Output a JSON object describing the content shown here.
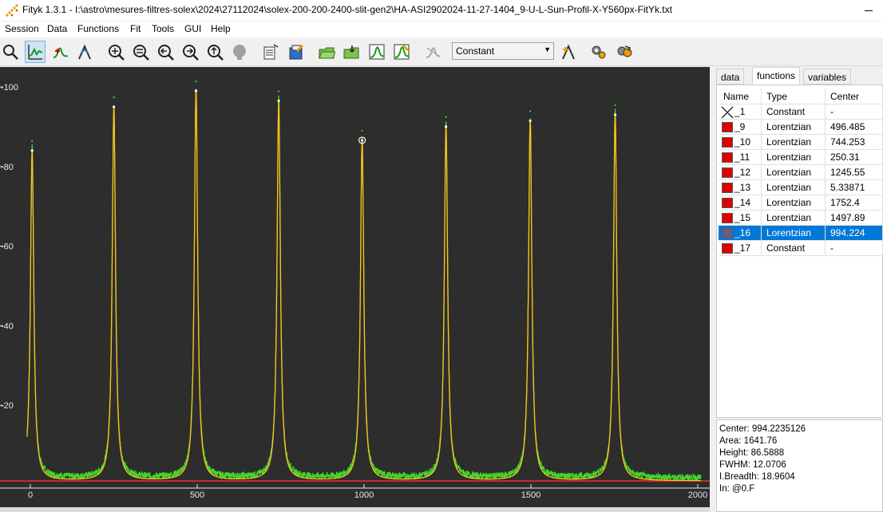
{
  "window": {
    "title": "Fityk 1.3.1 - I:\\astro\\mesures-filtres-solex\\2024\\27112024\\solex-200-200-2400-slit-gen2\\HA-ASI2902024-11-27-1404_9-U-L-Sun-Profil-X-Y560px-FitYk.txt"
  },
  "menu": [
    "Session",
    "Data",
    "Functions",
    "Fit",
    "Tools",
    "GUI",
    "Help"
  ],
  "toolbar": {
    "function_type": "Constant",
    "icons": [
      "zoom-mode-icon",
      "data-range-mode-icon",
      "add-peak-mode-icon",
      "baseline-mode-icon",
      "zoom-all-icon",
      "zoom-vertical-icon",
      "zoom-prev-icon",
      "zoom-in-icon",
      "zoom-up-icon",
      "disabled-circle-icon",
      "load-data-icon",
      "edit-data-icon",
      "open-session-icon",
      "save-session-icon",
      "run-fit-icon",
      "fit-settings-icon",
      "disabled-fit-icon",
      "guess-peak-icon",
      "run-script-icon",
      "continue-icon"
    ]
  },
  "colors": {
    "plot_bg": "#2d2d2d",
    "data": "#43d62d",
    "model": "#ffc21a",
    "baseline": "#ff2a2a",
    "accent": "#0078d7"
  },
  "chart_data": {
    "type": "line",
    "x_ticks": [
      "0",
      "500",
      "1000",
      "1500",
      "2000"
    ],
    "y_ticks": [
      "20",
      "40",
      "60",
      "80",
      "100"
    ],
    "xlim": [
      -10,
      2010
    ],
    "ylim": [
      0,
      104
    ],
    "baseline": 1.0,
    "peaks": [
      {
        "center": 5.33871,
        "height": 84.0,
        "fwhm": 12.0
      },
      {
        "center": 250.31,
        "height": 95.0,
        "fwhm": 12.0
      },
      {
        "center": 496.485,
        "height": 99.0,
        "fwhm": 12.0
      },
      {
        "center": 744.253,
        "height": 96.5,
        "fwhm": 12.0
      },
      {
        "center": 994.224,
        "height": 86.5888,
        "fwhm": 12.0706
      },
      {
        "center": 1245.55,
        "height": 90.0,
        "fwhm": 12.0
      },
      {
        "center": 1497.89,
        "height": 91.5,
        "fwhm": 12.0
      },
      {
        "center": 1752.4,
        "height": 93.0,
        "fwhm": 12.0
      }
    ]
  },
  "tabs": [
    "data",
    "functions",
    "variables"
  ],
  "functions": {
    "headers": [
      "Name",
      "Type",
      "Center"
    ],
    "rows": [
      {
        "name": "_1",
        "type": "Constant",
        "center": "-",
        "icon": "cross"
      },
      {
        "name": "_9",
        "type": "Lorentzian",
        "center": "496.485",
        "icon": "swatch"
      },
      {
        "name": "_10",
        "type": "Lorentzian",
        "center": "744.253",
        "icon": "swatch"
      },
      {
        "name": "_11",
        "type": "Lorentzian",
        "center": "250.31",
        "icon": "swatch"
      },
      {
        "name": "_12",
        "type": "Lorentzian",
        "center": "1245.55",
        "icon": "swatch"
      },
      {
        "name": "_13",
        "type": "Lorentzian",
        "center": "5.33871",
        "icon": "swatch"
      },
      {
        "name": "_14",
        "type": "Lorentzian",
        "center": "1752.4",
        "icon": "swatch"
      },
      {
        "name": "_15",
        "type": "Lorentzian",
        "center": "1497.89",
        "icon": "swatch"
      },
      {
        "name": "_16",
        "type": "Lorentzian",
        "center": "994.224",
        "icon": "swatch",
        "selected": true
      },
      {
        "name": "_17",
        "type": "Constant",
        "center": "-",
        "icon": "swatch"
      }
    ]
  },
  "info": {
    "center": "Center: 994.2235126",
    "area": "Area: 1641.76",
    "height": "Height: 86.5888",
    "fwhm": "FWHM: 12.0706",
    "ibreadth": "I.Breadth: 18.9604",
    "in": "In: @0.F"
  }
}
